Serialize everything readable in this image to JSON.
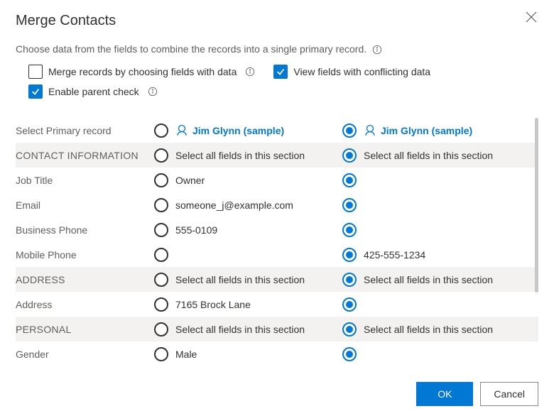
{
  "title": "Merge Contacts",
  "subtitle": "Choose data from the fields to combine the records into a single primary record.",
  "options": {
    "merge_by_fields": {
      "label": "Merge records by choosing fields with data",
      "checked": false
    },
    "view_conflicting": {
      "label": "View fields with conflicting data",
      "checked": true
    },
    "enable_parent": {
      "label": "Enable parent check",
      "checked": true
    }
  },
  "select_primary_label": "Select Primary record",
  "records": {
    "a": {
      "name": "Jim Glynn (sample)",
      "selected": false
    },
    "b": {
      "name": "Jim Glynn (sample)",
      "selected": true
    }
  },
  "select_all_label": "Select all fields in this section",
  "sections": [
    {
      "key": "contact",
      "label": "CONTACT INFORMATION",
      "a_selected": false,
      "b_selected": true,
      "fields": [
        {
          "label": "Job Title",
          "a": "Owner",
          "b": "",
          "sel": "b"
        },
        {
          "label": "Email",
          "a": "someone_j@example.com",
          "b": "",
          "sel": "b"
        },
        {
          "label": "Business Phone",
          "a": "555-0109",
          "b": "",
          "sel": "b"
        },
        {
          "label": "Mobile Phone",
          "a": "",
          "b": "425-555-1234",
          "sel": "b"
        }
      ]
    },
    {
      "key": "address",
      "label": "ADDRESS",
      "a_selected": false,
      "b_selected": true,
      "fields": [
        {
          "label": "Address",
          "a": "7165 Brock Lane",
          "b": "",
          "sel": "b"
        }
      ]
    },
    {
      "key": "personal",
      "label": "PERSONAL",
      "a_selected": false,
      "b_selected": true,
      "fields": [
        {
          "label": "Gender",
          "a": "Male",
          "b": "",
          "sel": "b"
        }
      ]
    }
  ],
  "buttons": {
    "ok": "OK",
    "cancel": "Cancel"
  }
}
